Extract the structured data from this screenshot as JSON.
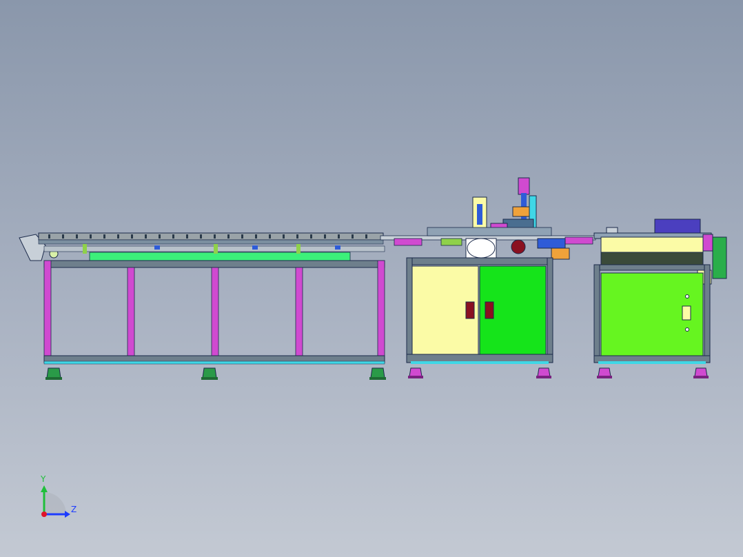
{
  "viewport": {
    "background_top": "#8a97ab",
    "background_bottom": "#c3c9d3"
  },
  "triad": {
    "y_label": "Y",
    "z_label": "Z",
    "y_color": "#1fbf3a",
    "z_color": "#1d3cff",
    "x_color": "#e0142a"
  },
  "colors": {
    "frame": "#6e7f8c",
    "frame_edge": "#1b2a4a",
    "magenta": "#d04ad0",
    "pale_yellow": "#fbfba6",
    "green_door": "#15e41a",
    "lime_panel": "#66f520",
    "green_plate": "#3cf07a",
    "blue": "#2f5cd8",
    "orange": "#f0a23a",
    "dark_red": "#8a1020",
    "feet_green": "#2a9a48",
    "feet_pink": "#d04ad0",
    "cyan": "#3fd7e6"
  }
}
